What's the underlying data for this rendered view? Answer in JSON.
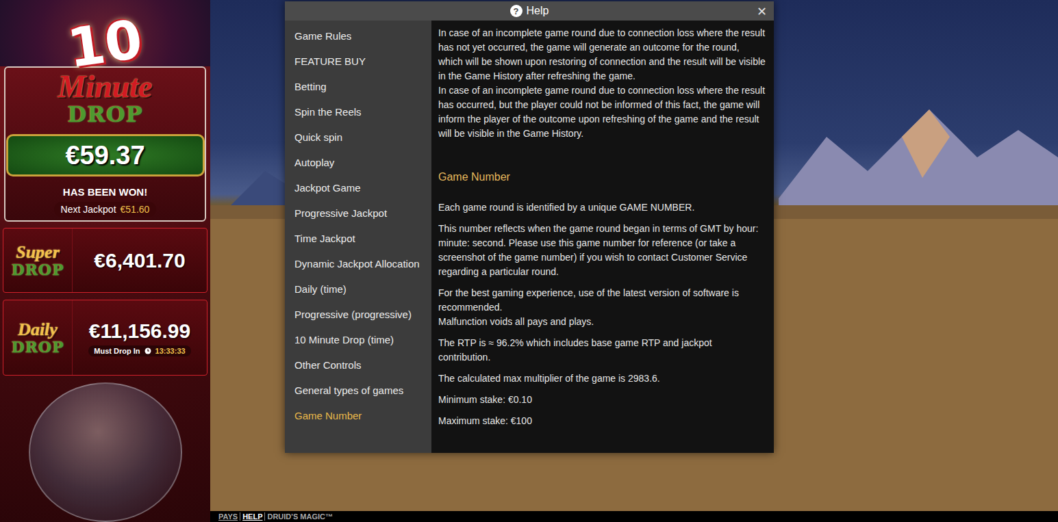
{
  "jackpots": {
    "ten_minute": {
      "logo": {
        "number": "10",
        "word": "Minute",
        "drop": "DROP"
      },
      "amount": "€59.37",
      "status": "HAS BEEN WON!",
      "next_label": "Next Jackpot",
      "next_amount": "€51.60"
    },
    "super": {
      "logo": {
        "word": "Super",
        "drop": "DROP"
      },
      "amount": "€6,401.70"
    },
    "daily": {
      "logo": {
        "word": "Daily",
        "drop": "DROP"
      },
      "amount": "€11,156.99",
      "timer_label": "Must Drop In",
      "timer": "13:33:33"
    }
  },
  "dialog": {
    "icon": "?",
    "title": "Help",
    "close": "✕",
    "menu": [
      {
        "label": "Game Rules",
        "selected": false
      },
      {
        "label": "FEATURE BUY",
        "selected": false
      },
      {
        "label": "Betting",
        "selected": false
      },
      {
        "label": "Spin the Reels",
        "selected": false
      },
      {
        "label": "Quick spin",
        "selected": false
      },
      {
        "label": "Autoplay",
        "selected": false
      },
      {
        "label": "Jackpot Game",
        "selected": false
      },
      {
        "label": "Progressive Jackpot",
        "selected": false
      },
      {
        "label": "Time Jackpot",
        "selected": false
      },
      {
        "label": "Dynamic Jackpot Allocation",
        "selected": false
      },
      {
        "label": "Daily (time)",
        "selected": false
      },
      {
        "label": "Progressive (progressive)",
        "selected": false
      },
      {
        "label": "10 Minute Drop (time)",
        "selected": false
      },
      {
        "label": "Other Controls",
        "selected": false
      },
      {
        "label": "General types of games",
        "selected": false
      },
      {
        "label": "Game Number",
        "selected": true
      }
    ],
    "content": [
      {
        "kind": "paragraph",
        "lines": [
          "In case of an incomplete game round due to connection loss where the result has not yet occurred, the game will generate an outcome for the round, which will be shown upon restoring of connection and the result will be visible in the Game History after refreshing the game.",
          "In case of an incomplete game round due to connection loss where the result has occurred, but the player could not be informed of this fact, the game will inform the player of the outcome upon refreshing of the game and the result will be visible in the Game History."
        ]
      },
      {
        "kind": "heading",
        "lines": [
          "Game Number"
        ]
      },
      {
        "kind": "paragraph",
        "lines": [
          "Each game round is identified by a unique GAME NUMBER."
        ]
      },
      {
        "kind": "paragraph",
        "lines": [
          "This number reflects when the game round began in terms of GMT by hour: minute: second. Please use this game number for reference (or take a screenshot of the game number) if you wish to contact Customer Service regarding a particular round."
        ]
      },
      {
        "kind": "paragraph",
        "lines": [
          "For the best gaming experience, use of the latest version of software is recommended.",
          "Malfunction voids all pays and plays."
        ]
      },
      {
        "kind": "paragraph",
        "lines": [
          "The RTP is ≈ 96.2% which includes base game RTP and jackpot contribution."
        ]
      },
      {
        "kind": "paragraph",
        "lines": [
          "The calculated max multiplier of the game is 2983.6."
        ]
      },
      {
        "kind": "paragraph",
        "lines": [
          "Minimum stake: €0.10"
        ]
      },
      {
        "kind": "paragraph",
        "lines": [
          "Maximum stake: €100"
        ]
      }
    ]
  },
  "bottom_bar": [
    {
      "label": "PAYS",
      "selected": false
    },
    {
      "label": "HELP",
      "selected": true
    },
    {
      "label": "DRUID'S MAGIC™",
      "selected": false
    }
  ]
}
